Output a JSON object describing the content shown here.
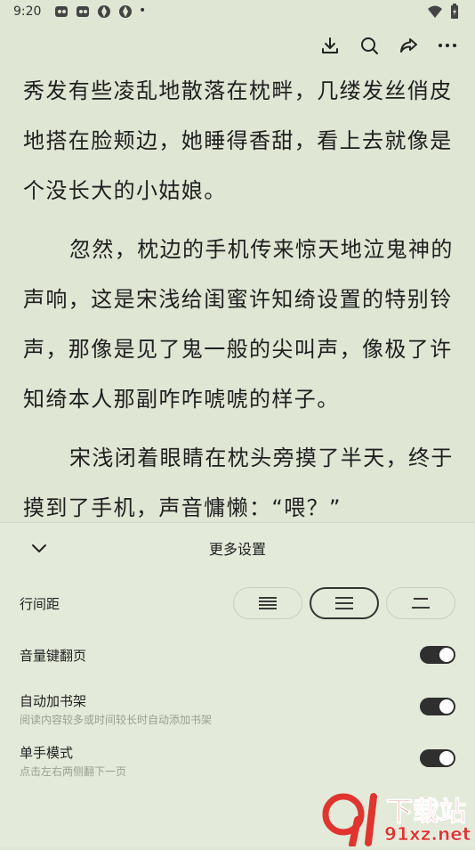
{
  "status_bar": {
    "time": "9:20",
    "dot": "•"
  },
  "toolbar": {
    "icons": [
      "download-icon",
      "search-icon",
      "share-icon",
      "more-icon"
    ]
  },
  "reader": {
    "paragraphs": [
      "秀发有些凌乱地散落在枕畔，几缕发丝俏皮地搭在脸颊边，她睡得香甜，看上去就像是个没长大的小姑娘。",
      "忽然，枕边的手机传来惊天地泣鬼神的声响，这是宋浅给闺蜜许知绮设置的特别铃声，那像是见了鬼一般的尖叫声，像极了许知绮本人那副咋咋唬唬的样子。",
      "宋浅闭着眼睛在枕头旁摸了半天，终于摸到了手机，声音慵懒：“喂？”"
    ]
  },
  "settings_panel": {
    "title": "更多设置",
    "line_spacing": {
      "label": "行间距",
      "options": [
        "compact",
        "medium",
        "loose"
      ],
      "selected": "medium"
    },
    "volume_page_turn": {
      "label": "音量键翻页",
      "enabled": true
    },
    "auto_bookshelf": {
      "label": "自动加书架",
      "subtitle": "阅读内容较多或时间较长时自动添加书架",
      "enabled": true
    },
    "one_hand_mode": {
      "label": "单手模式",
      "subtitle": "点击左右两侧翻下一页",
      "enabled": true
    }
  },
  "watermark": {
    "text_cn": "下载站",
    "text_url": "91xz.net"
  },
  "colors": {
    "background": "#dfe6d4",
    "toggle_on": "#2f2f2f",
    "watermark_red": "#e0342f"
  }
}
